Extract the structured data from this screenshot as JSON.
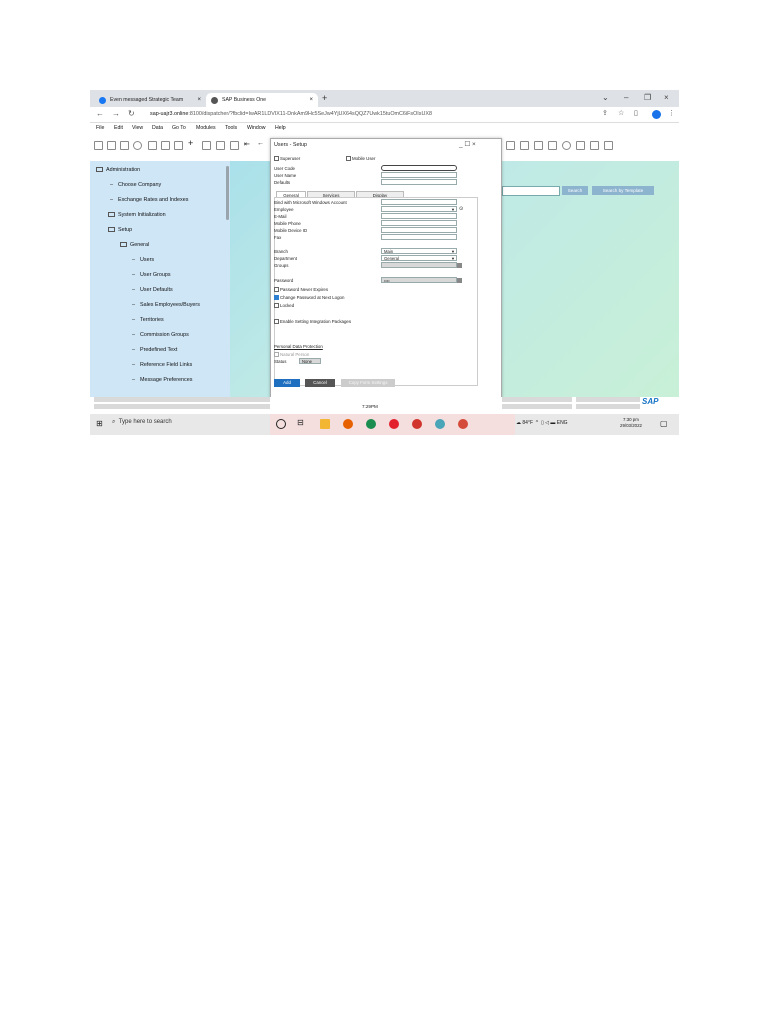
{
  "browser": {
    "tabs": [
      {
        "label": "Even messaged Strategic Team"
      },
      {
        "label": "SAP Business One"
      }
    ],
    "url_host": "sap-uajr3.online",
    "url_path": ":8100/dispatcher/?fbclid=IwAR1LDVIX11-DnkAm9Hc5SeJw4YjUX64sQQZ7Uwk15tuOmC6iFsOIsUX8"
  },
  "menu": {
    "items": [
      "File",
      "Edit",
      "View",
      "Data",
      "Go To",
      "Modules",
      "Tools",
      "Window",
      "Help"
    ]
  },
  "sidebar": {
    "root": "Administration",
    "items": [
      {
        "label": "Choose Company",
        "kind": "leaf",
        "indent": 1
      },
      {
        "label": "Exchange Rates and Indexes",
        "kind": "leaf",
        "indent": 1
      },
      {
        "label": "System Initialization",
        "kind": "folder",
        "indent": 1
      },
      {
        "label": "Setup",
        "kind": "folder",
        "indent": 1
      },
      {
        "label": "General",
        "kind": "folder",
        "indent": 2
      },
      {
        "label": "Users",
        "kind": "leaf",
        "indent": 3
      },
      {
        "label": "User Groups",
        "kind": "leaf",
        "indent": 3
      },
      {
        "label": "User Defaults",
        "kind": "leaf",
        "indent": 3
      },
      {
        "label": "Sales Employees/Buyers",
        "kind": "leaf",
        "indent": 3
      },
      {
        "label": "Territories",
        "kind": "leaf",
        "indent": 3
      },
      {
        "label": "Commission Groups",
        "kind": "leaf",
        "indent": 3
      },
      {
        "label": "Predefined Text",
        "kind": "leaf",
        "indent": 3
      },
      {
        "label": "Reference Field Links",
        "kind": "leaf",
        "indent": 3
      },
      {
        "label": "Message Preferences",
        "kind": "leaf",
        "indent": 3
      }
    ]
  },
  "search": {
    "button": "Search",
    "template_button": "Search by Template"
  },
  "dialog": {
    "title": "Users - Setup",
    "superuser": "Superuser",
    "mobile_user": "Mobile User",
    "user_code": "User Code",
    "user_name": "User Name",
    "defaults": "Defaults",
    "tabs": [
      "General",
      "Services",
      "Display"
    ],
    "bind_windows": "Bind with Microsoft Windows Account",
    "employee": "Employee",
    "email": "E-Mail",
    "mobile_phone": "Mobile Phone",
    "mobile_device": "Mobile Device ID",
    "fax": "Fax",
    "branch": "Branch",
    "branch_value": "Main",
    "department": "Department",
    "department_value": "General",
    "groups": "Groups",
    "password": "Password",
    "password_value": "••••",
    "password_never_expires": "Password Never Expires",
    "change_password": "Change Password at Next Logon",
    "locked": "Locked",
    "enable_setting": "Enable Setting Integration Packages",
    "personal_data": "Personal Data Protection",
    "natural_person": "Natural Person",
    "status_label": "Status",
    "status_value": "None",
    "add": "Add",
    "cancel": "Cancel",
    "copy_settings": "Copy Form Settings"
  },
  "statusbar": {
    "time": "7:29PM",
    "logo": "SAP"
  },
  "taskbar": {
    "search": "Type here to search",
    "weather": "84°F",
    "lang": "ENG",
    "time": "7:30 pm",
    "date": "29/03/2022"
  },
  "colors": {
    "sidebar_bg": "#cfe6f7",
    "accent": "#1f6fc0",
    "cancel": "#555555"
  }
}
